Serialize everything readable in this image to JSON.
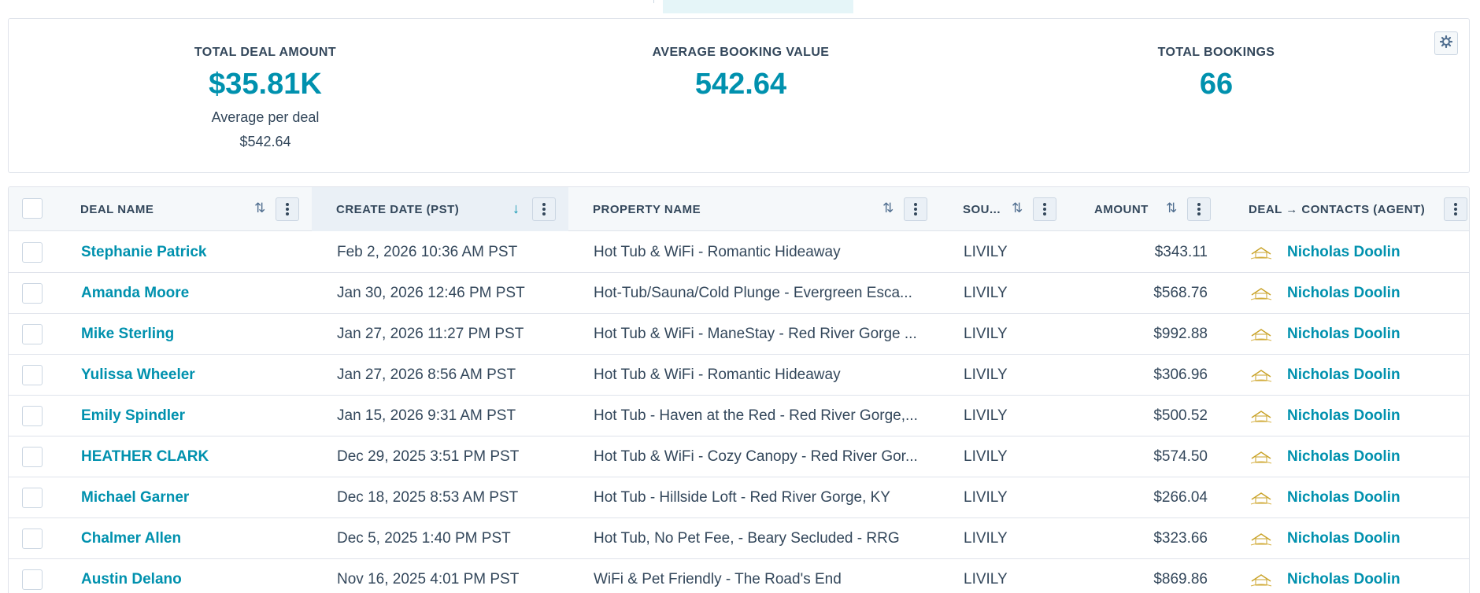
{
  "summary": {
    "kpis": [
      {
        "label": "TOTAL DEAL AMOUNT",
        "value": "$35.81K",
        "sub_label": "Average per deal",
        "sub_value": "$542.64"
      },
      {
        "label": "AVERAGE BOOKING VALUE",
        "value": "542.64"
      },
      {
        "label": "TOTAL BOOKINGS",
        "value": "66"
      }
    ],
    "settings_icon": "gear-icon"
  },
  "table": {
    "columns": [
      {
        "label": "DEAL NAME",
        "sort": "none"
      },
      {
        "label": "CREATE DATE (PST)",
        "sort": "descending"
      },
      {
        "label": "PROPERTY NAME",
        "sort": "none"
      },
      {
        "label": "SOU...",
        "sort": "none"
      },
      {
        "label": "AMOUNT",
        "sort": "none"
      },
      {
        "label": "DEAL → CONTACTS (AGENT)",
        "sort": "none"
      }
    ],
    "rows": [
      {
        "deal_name": "Stephanie Patrick",
        "create_date": "Feb 2, 2026 10:36 AM PST",
        "property": "Hot Tub & WiFi - Romantic Hideaway",
        "source": "LIVILY",
        "amount": "$343.11",
        "agent": "Nicholas Doolin"
      },
      {
        "deal_name": "Amanda Moore",
        "create_date": "Jan 30, 2026 12:46 PM PST",
        "property": "Hot-Tub/Sauna/Cold Plunge - Evergreen Esca...",
        "source": "LIVILY",
        "amount": "$568.76",
        "agent": "Nicholas Doolin"
      },
      {
        "deal_name": "Mike Sterling",
        "create_date": "Jan 27, 2026 11:27 PM PST",
        "property": "Hot Tub & WiFi - ManeStay - Red River Gorge ...",
        "source": "LIVILY",
        "amount": "$992.88",
        "agent": "Nicholas Doolin"
      },
      {
        "deal_name": "Yulissa Wheeler",
        "create_date": "Jan 27, 2026 8:56 AM PST",
        "property": "Hot Tub & WiFi - Romantic Hideaway",
        "source": "LIVILY",
        "amount": "$306.96",
        "agent": "Nicholas Doolin"
      },
      {
        "deal_name": "Emily Spindler",
        "create_date": "Jan 15, 2026 9:31 AM PST",
        "property": "Hot Tub - Haven at the Red - Red River Gorge,...",
        "source": "LIVILY",
        "amount": "$500.52",
        "agent": "Nicholas Doolin"
      },
      {
        "deal_name": "HEATHER CLARK",
        "create_date": "Dec 29, 2025 3:51 PM PST",
        "property": "Hot Tub & WiFi - Cozy Canopy - Red River Gor...",
        "source": "LIVILY",
        "amount": "$574.50",
        "agent": "Nicholas Doolin"
      },
      {
        "deal_name": "Michael Garner",
        "create_date": "Dec 18, 2025 8:53 AM PST",
        "property": "Hot Tub - Hillside Loft - Red River Gorge, KY",
        "source": "LIVILY",
        "amount": "$266.04",
        "agent": "Nicholas Doolin"
      },
      {
        "deal_name": "Chalmer Allen",
        "create_date": "Dec 5, 2025 1:40 PM PST",
        "property": "Hot Tub, No Pet Fee, - Beary Secluded - RRG",
        "source": "LIVILY",
        "amount": "$323.66",
        "agent": "Nicholas Doolin"
      },
      {
        "deal_name": "Austin Delano",
        "create_date": "Nov 16, 2025 4:01 PM PST",
        "property": "WiFi & Pet Friendly - The Road's End",
        "source": "LIVILY",
        "amount": "$869.86",
        "agent": "Nicholas Doolin"
      }
    ],
    "agent_logo_icon": "staycation-logo-icon"
  },
  "colors": {
    "accent": "#0091ae",
    "text": "#33475b",
    "border": "#dfe3eb",
    "header_bg": "#f5f8fa"
  }
}
